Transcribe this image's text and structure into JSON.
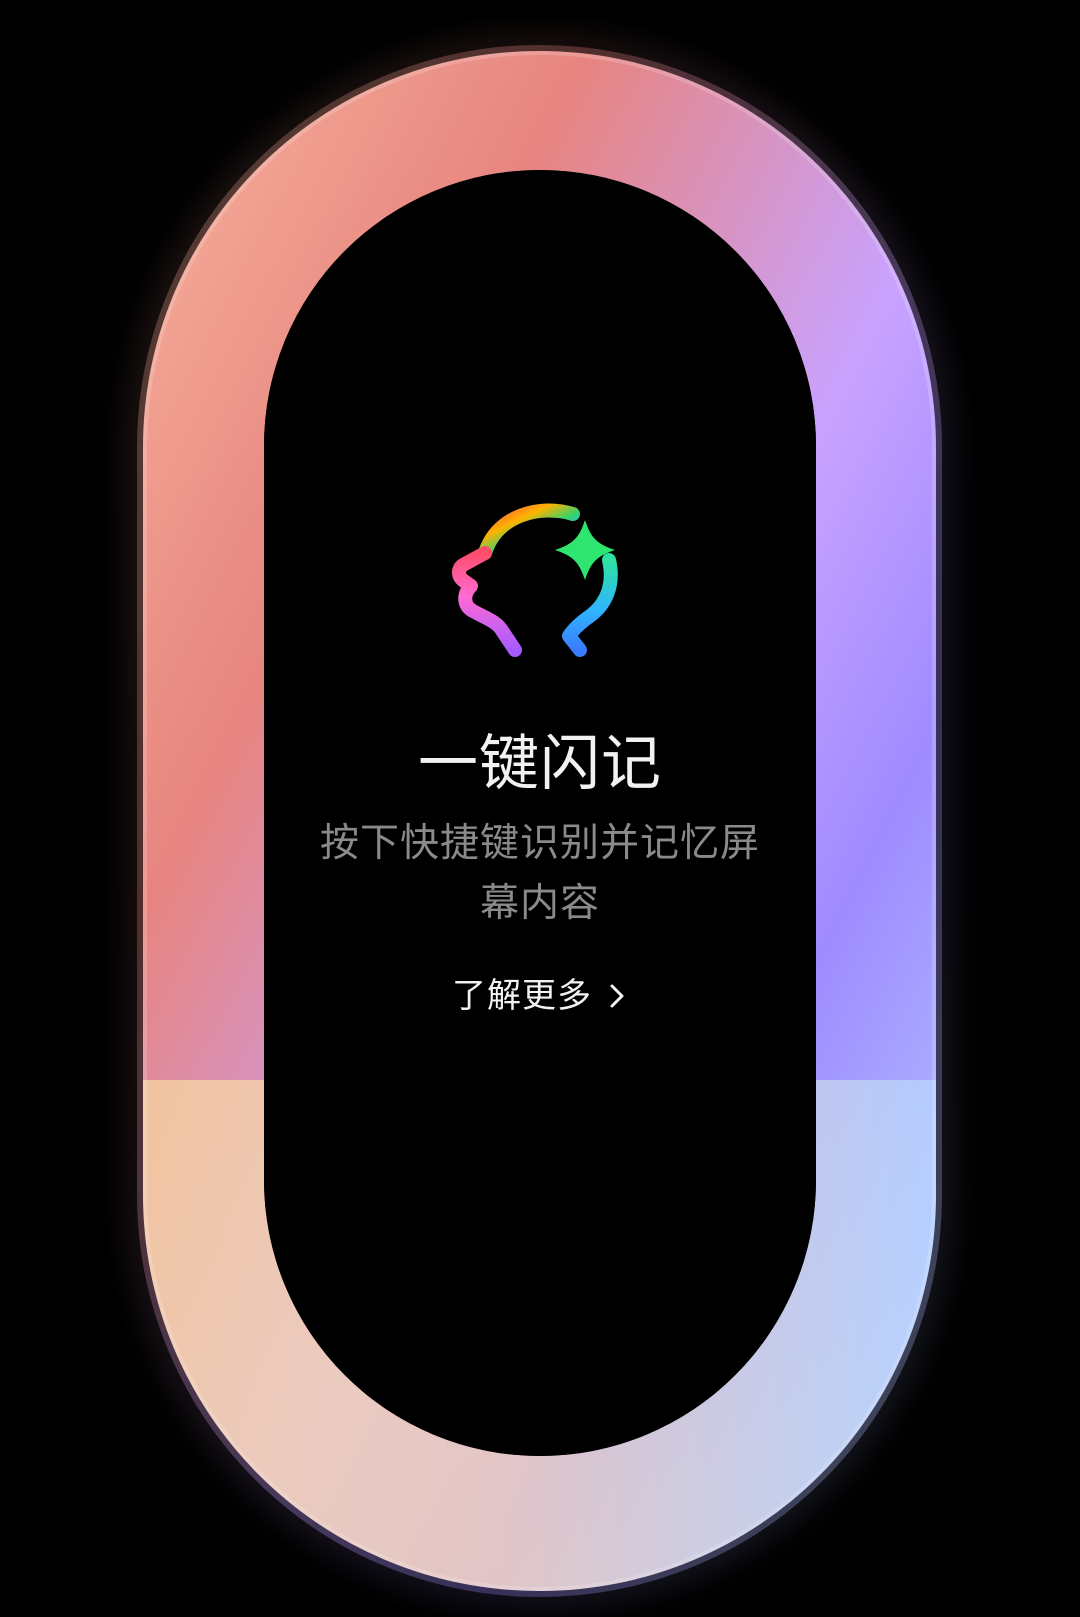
{
  "feature": {
    "title": "一键闪记",
    "subtitle": "按下快捷键识别并记忆屏幕内容",
    "learn_more_label": "了解更多"
  },
  "icons": {
    "logo": "memory-head-sparkle-icon",
    "chevron": "chevron-right-icon"
  },
  "colors": {
    "background": "#000000",
    "ring_top": "#f6b7a5",
    "ring_left": "#e98583",
    "ring_right": "#a38bff",
    "ring_bottom": "#f6d9a0",
    "title": "#f2f2f2",
    "subtitle": "#8a8a8a"
  }
}
